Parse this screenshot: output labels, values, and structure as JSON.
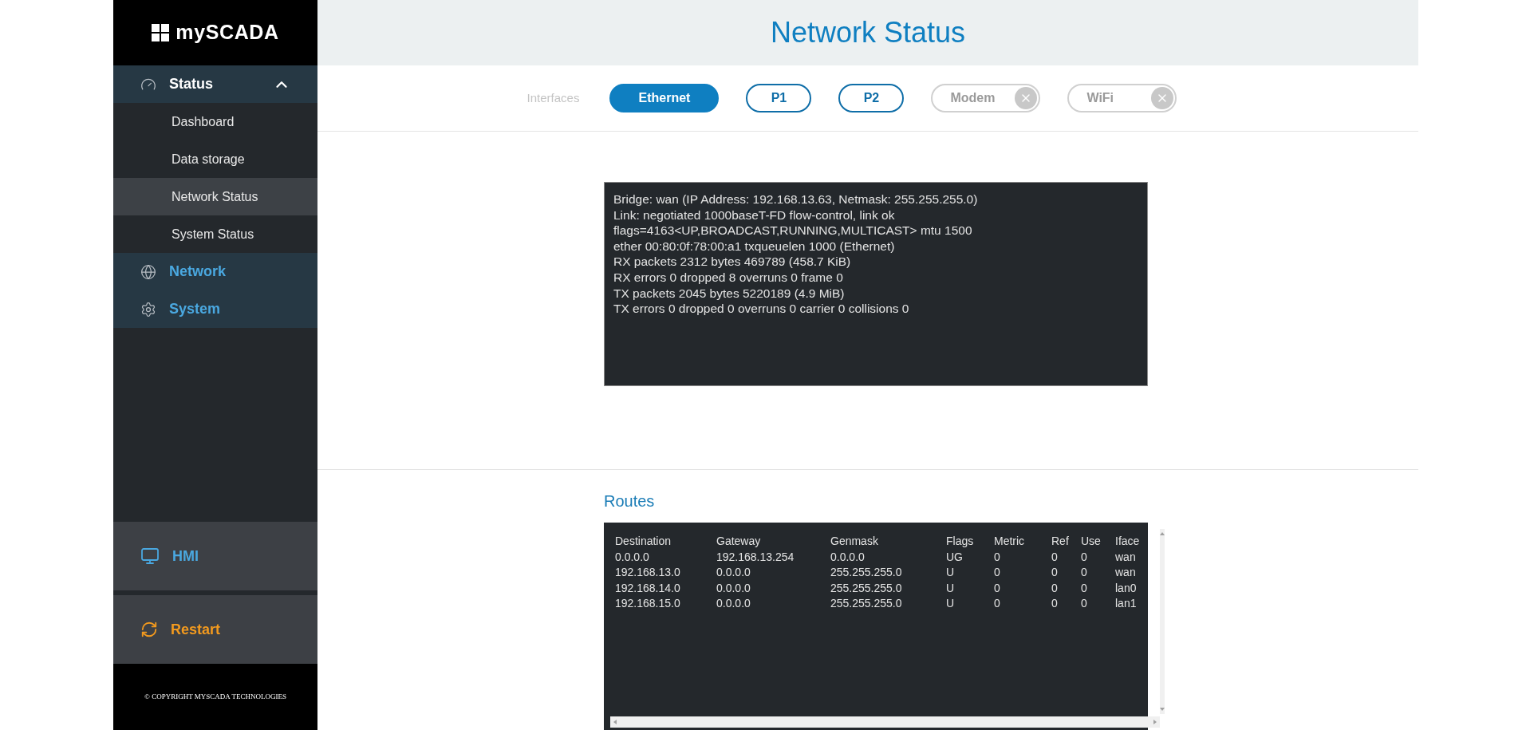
{
  "sidebar": {
    "logo": "mySCADA",
    "sections": [
      {
        "label": "Status",
        "expanded": true,
        "children": [
          {
            "label": "Dashboard",
            "selected": false
          },
          {
            "label": "Data storage",
            "selected": false
          },
          {
            "label": "Network Status",
            "selected": true
          },
          {
            "label": "System Status",
            "selected": false
          }
        ]
      },
      {
        "label": "Network",
        "expanded": false
      },
      {
        "label": "System",
        "expanded": false
      }
    ],
    "hmi": "HMI",
    "restart": "Restart",
    "copyright": "© COPYRIGHT MYSCADA TECHNOLOGIES"
  },
  "page_title": "Network Status",
  "interfaces": {
    "label": "Interfaces",
    "tabs": [
      {
        "label": "Ethernet",
        "selected": true,
        "disabled": false
      },
      {
        "label": "P1",
        "selected": false,
        "disabled": false
      },
      {
        "label": "P2",
        "selected": false,
        "disabled": false
      },
      {
        "label": "Modem",
        "selected": false,
        "disabled": true
      },
      {
        "label": "WiFi",
        "selected": false,
        "disabled": true
      }
    ]
  },
  "interface_info": [
    "Bridge: wan (IP Address: 192.168.13.63, Netmask: 255.255.255.0)",
    "Link: negotiated 1000baseT-FD flow-control, link ok",
    "flags=4163<UP,BROADCAST,RUNNING,MULTICAST> mtu 1500",
    "ether 00:80:0f:78:00:a1 txqueuelen 1000 (Ethernet)",
    "RX packets 2312 bytes 469789 (458.7 KiB)",
    "RX errors 0 dropped 8 overruns 0 frame 0",
    "TX packets 2045 bytes 5220189 (4.9 MiB)",
    "TX errors 0 dropped 0 overruns 0 carrier 0 collisions 0"
  ],
  "routes": {
    "title": "Routes",
    "columns": [
      "Destination",
      "Gateway",
      "Genmask",
      "Flags",
      "Metric",
      "Ref",
      "Use",
      "Iface"
    ],
    "rows": [
      [
        "0.0.0.0",
        "192.168.13.254",
        "0.0.0.0",
        "UG",
        "0",
        "0",
        "0",
        "wan"
      ],
      [
        "192.168.13.0",
        "0.0.0.0",
        "255.255.255.0",
        "U",
        "0",
        "0",
        "0",
        "wan"
      ],
      [
        "192.168.14.0",
        "0.0.0.0",
        "255.255.255.0",
        "U",
        "0",
        "0",
        "0",
        "lan0"
      ],
      [
        "192.168.15.0",
        "0.0.0.0",
        "255.255.255.0",
        "U",
        "0",
        "0",
        "0",
        "lan1"
      ]
    ]
  }
}
